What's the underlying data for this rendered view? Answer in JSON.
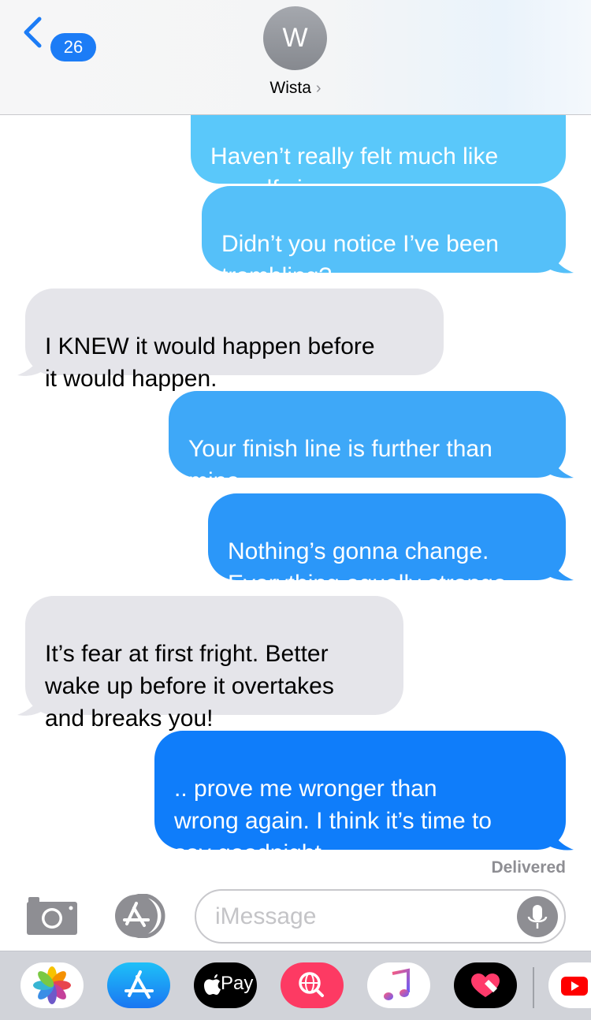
{
  "header": {
    "back_count": "26",
    "avatar_initial": "W",
    "contact_name": "Wista",
    "contact_chevron": "›"
  },
  "messages": [
    {
      "from": "me",
      "text": "Haven’t really felt much like\nmyself since summer"
    },
    {
      "from": "me",
      "text": "Didn’t you notice I’ve been\ntrembling?"
    },
    {
      "from": "them",
      "text": "I KNEW it would happen before\nit would happen."
    },
    {
      "from": "me",
      "text": "Your finish line is further than\nmine..."
    },
    {
      "from": "me",
      "text": "Nothing’s gonna change.\nEverything equally strange"
    },
    {
      "from": "them",
      "text": "It’s fear at first fright. Better\nwake up before it overtakes\nand breaks you!"
    },
    {
      "from": "me",
      "text": ".. prove me wronger than\nwrong again. I think it’s time to\nsay goodnight"
    }
  ],
  "status": {
    "delivered": "Delivered"
  },
  "input": {
    "placeholder": "iMessage"
  },
  "apps": [
    {
      "name": "Photos",
      "icon": "photos-icon"
    },
    {
      "name": "App Store",
      "icon": "app-store-icon"
    },
    {
      "name": "Apple Pay",
      "icon": "apple-pay-icon",
      "label": "Pay"
    },
    {
      "name": "Search Images",
      "icon": "globe-search-icon"
    },
    {
      "name": "Music",
      "icon": "music-note-icon"
    },
    {
      "name": "Digital Touch",
      "icon": "heart-touch-icon"
    },
    {
      "name": "YouTube",
      "icon": "youtube-icon"
    }
  ],
  "colors": {
    "sent_top": "#5ac8fa",
    "sent_bottom": "#0a7aff",
    "received": "#e5e5ea",
    "badge": "#1c7cf6"
  }
}
